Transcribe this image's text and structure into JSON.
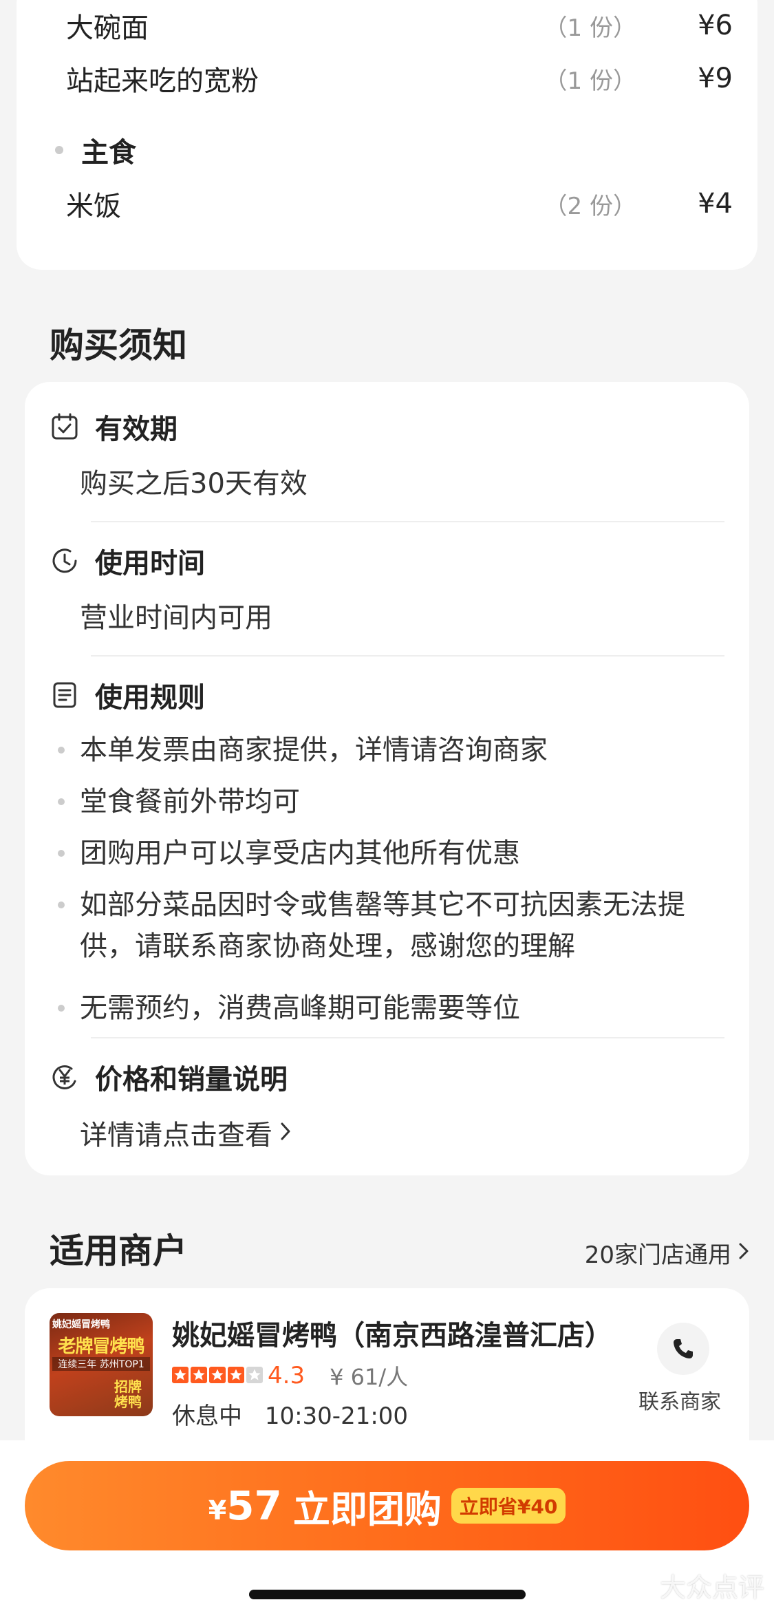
{
  "dishes": {
    "rows": [
      {
        "name": "大碗面",
        "qty": "（1 份）",
        "price": "¥6"
      },
      {
        "name": "站起来吃的宽粉",
        "qty": "（1 份）",
        "price": "¥9"
      }
    ],
    "group": {
      "title": "主食",
      "rows": [
        {
          "name": "米饭",
          "qty": "（2 份）",
          "price": "¥4"
        }
      ]
    }
  },
  "notice": {
    "title": "购买须知",
    "validity": {
      "label": "有效期",
      "text": "购买之后30天有效"
    },
    "usage_time": {
      "label": "使用时间",
      "text": "营业时间内可用"
    },
    "rules": {
      "label": "使用规则",
      "items": [
        "本单发票由商家提供，详情请咨询商家",
        "堂食餐前外带均可",
        "团购用户可以享受店内其他所有优惠",
        "如部分菜品因时令或售罄等其它不可抗因素无法提供，请联系商家协商处理，感谢您的理解",
        "无需预约，消费高峰期可能需要等位"
      ]
    },
    "price_info": {
      "label": "价格和销量说明",
      "link": "详情请点击查看"
    }
  },
  "stores": {
    "title": "适用商户",
    "count_link": "20家门店通用",
    "merchant": {
      "name": "姚妃媱冒烤鸭（南京西路湟普汇店）",
      "thumb_text_brand": "姚妃媱冒烤鸭",
      "thumb_text_main": "老牌冒烤鸭",
      "thumb_text_sub": "连续三年 苏州TOP1",
      "thumb_text_corner": "招牌烤鸭",
      "rating": 4.3,
      "stars": 4,
      "score": "4.3",
      "avg_price": "¥ 61/人",
      "status": "休息中",
      "hours": "10:30-21:00",
      "call_label": "联系商家"
    }
  },
  "buy": {
    "currency": "¥",
    "amount": "57",
    "action": "立即团购",
    "save_tag": "立即省¥40"
  },
  "watermark": "大众点评",
  "colors": {
    "accent": "#ff5a1f",
    "button_start": "#ff8a2c",
    "button_end": "#ff4f12",
    "save_tag_bg": "#ffd84a"
  }
}
